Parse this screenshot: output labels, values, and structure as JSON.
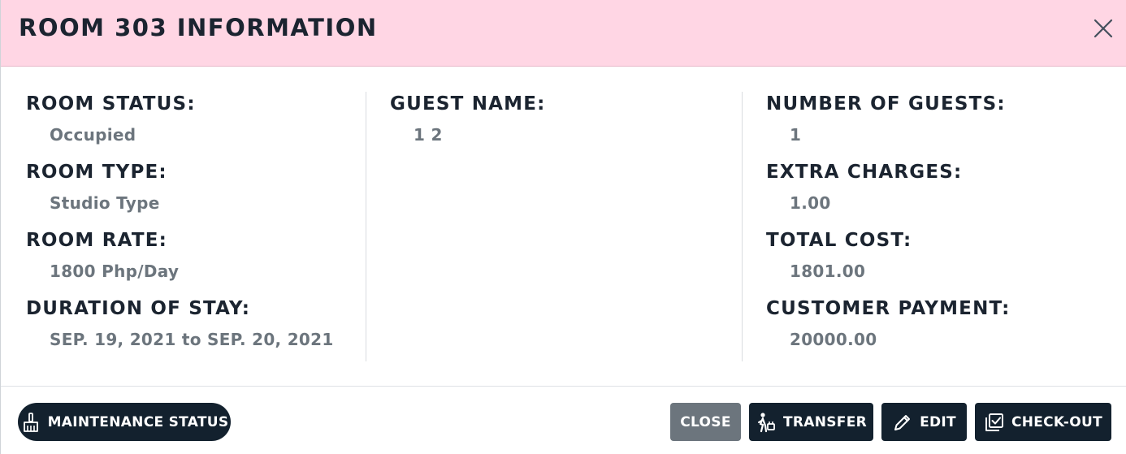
{
  "header": {
    "title": "ROOM 303 INFORMATION"
  },
  "left": {
    "room_status_label": "ROOM STATUS:",
    "room_status_value": "Occupied",
    "room_type_label": "ROOM TYPE:",
    "room_type_value": "Studio Type",
    "room_rate_label": "ROOM RATE:",
    "room_rate_value": "1800 Php/Day",
    "duration_label": "DURATION OF STAY:",
    "duration_value": "SEP. 19, 2021 to SEP. 20, 2021"
  },
  "middle": {
    "guest_name_label": "GUEST NAME:",
    "guest_name_value": "1 2"
  },
  "right": {
    "num_guests_label": "NUMBER OF GUESTS:",
    "num_guests_value": "1",
    "extra_charges_label": "EXTRA CHARGES:",
    "extra_charges_value": "1.00",
    "total_cost_label": "TOTAL COST:",
    "total_cost_value": "1801.00",
    "payment_label": "CUSTOMER PAYMENT:",
    "payment_value": "20000.00"
  },
  "footer": {
    "maintenance_label": "MAINTENANCE STATUS",
    "close_label": "CLOSE",
    "transfer_label": "TRANSFER",
    "edit_label": "EDIT",
    "checkout_label": "CHECK-OUT"
  },
  "icons": {
    "close": "close-icon",
    "maintenance": "broom-icon",
    "transfer": "person-walking-luggage-icon",
    "edit": "pencil-icon",
    "checkout": "check-box-icon"
  },
  "colors": {
    "header_bg": "#ffd6e4",
    "primary_button": "#13212e",
    "secondary_button": "#6c757d",
    "label_text": "#1b2430",
    "value_text": "#6c757d"
  }
}
